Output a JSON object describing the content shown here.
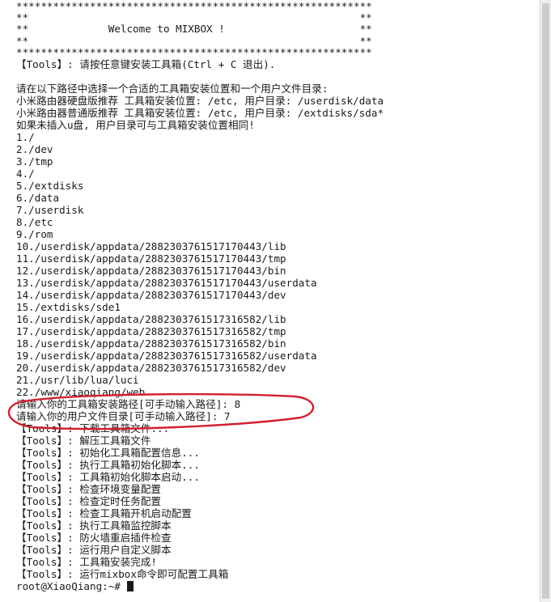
{
  "terminal": {
    "banner": [
      "**********************************************************",
      "**                                                      **",
      "**             Welcome to MIXBOX !                      **",
      "**                                                      **",
      "**********************************************************"
    ],
    "intro": "【Tools】: 请按任意键安装工具箱(Ctrl + C 退出).",
    "hints": [
      "请在以下路径中选择一个合适的工具箱安装位置和一个用户文件目录:",
      "小米路由器硬盘版推荐 工具箱安装位置: /etc, 用户目录: /userdisk/data",
      "小米路由器普通版推荐 工具箱安装位置: /etc, 用户目录: /extdisks/sda*",
      "如果未插入u盘, 用户目录可与工具箱安装位置相同!"
    ],
    "paths": [
      "1./",
      "2./dev",
      "3./tmp",
      "4./",
      "5./extdisks",
      "6./data",
      "7./userdisk",
      "8./etc",
      "9./rom",
      "10./userdisk/appdata/2882303761517170443/lib",
      "11./userdisk/appdata/2882303761517170443/tmp",
      "12./userdisk/appdata/2882303761517170443/bin",
      "13./userdisk/appdata/2882303761517170443/userdata",
      "14./userdisk/appdata/2882303761517170443/dev",
      "15./extdisks/sde1",
      "16./userdisk/appdata/2882303761517316582/lib",
      "17./userdisk/appdata/2882303761517316582/tmp",
      "18./userdisk/appdata/2882303761517316582/bin",
      "19./userdisk/appdata/2882303761517316582/userdata",
      "20./userdisk/appdata/2882303761517316582/dev",
      "21./usr/lib/lua/luci",
      "22./www/xiaoqiang/web"
    ],
    "prompts": [
      "请输入你的工具箱安装路径[可手动输入路径]: 8",
      "请输入你的用户文件目录[可手动输入路径]: 7"
    ],
    "steps": [
      "【Tools】: 下载工具箱文件...",
      "【Tools】: 解压工具箱文件",
      "【Tools】: 初始化工具箱配置信息...",
      "【Tools】: 执行工具箱初始化脚本...",
      "【Tools】: 工具箱初始化脚本启动...",
      "【Tools】: 检查环境变量配置",
      "【Tools】: 检查定时任务配置",
      "【Tools】: 检查工具箱开机启动配置",
      "【Tools】: 执行工具箱监控脚本",
      "【Tools】: 防火墙重启插件检查",
      "【Tools】: 运行用户自定义脚本",
      "【Tools】: 工具箱安装完成!",
      "【Tools】: 运行mixbox命令即可配置工具箱"
    ],
    "shell_prompt": "root@XiaoQiang:~# "
  },
  "colors": {
    "background": "#ffffff",
    "text": "#1a1a1a",
    "highlight": "#d2202f"
  }
}
